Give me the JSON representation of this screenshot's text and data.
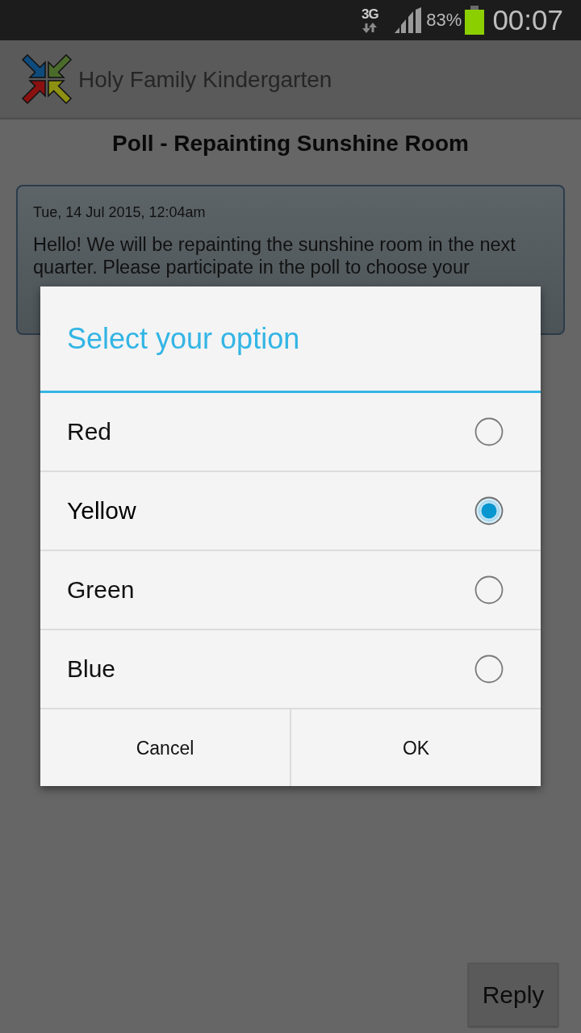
{
  "status_bar": {
    "network": "3G",
    "battery_percent": "83%",
    "time": "00:07"
  },
  "app_bar": {
    "title": "Holy Family Kindergarten"
  },
  "page": {
    "title": "Poll - Repainting Sunshine Room",
    "message": {
      "date": "Tue, 14 Jul 2015, 12:04am",
      "body": "Hello! We will be repainting the sunshine room in the next quarter. Please participate in the poll to choose your"
    },
    "reply_button": "Reply"
  },
  "dialog": {
    "title": "Select your option",
    "options": [
      {
        "label": "Red",
        "selected": false
      },
      {
        "label": "Yellow",
        "selected": true
      },
      {
        "label": "Green",
        "selected": false
      },
      {
        "label": "Blue",
        "selected": false
      }
    ],
    "buttons": [
      "Cancel",
      "OK"
    ]
  }
}
